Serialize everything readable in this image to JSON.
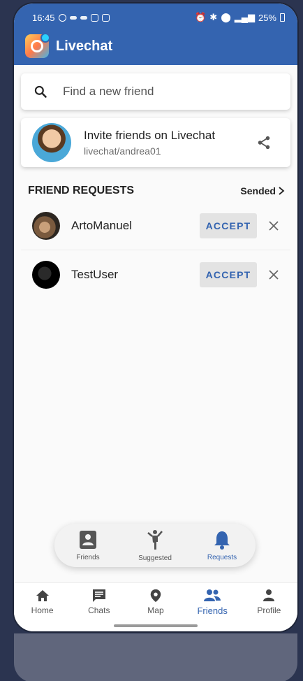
{
  "status": {
    "time": "16:45",
    "battery": "25%"
  },
  "app": {
    "title": "Livechat"
  },
  "search": {
    "placeholder": "Find a new friend"
  },
  "invite": {
    "title": "Invite friends on Livechat",
    "subtitle": "livechat/andrea01"
  },
  "requests": {
    "title": "FRIEND REQUESTS",
    "sended_label": "Sended",
    "items": [
      {
        "name": "ArtoManuel",
        "accept_label": "ACCEPT"
      },
      {
        "name": "TestUser",
        "accept_label": "ACCEPT"
      }
    ]
  },
  "friends_tabs": [
    {
      "label": "Friends",
      "icon": "contact-card-icon"
    },
    {
      "label": "Suggested",
      "icon": "person-wave-icon"
    },
    {
      "label": "Requests",
      "icon": "bell-icon",
      "active": true
    }
  ],
  "bottom_nav": [
    {
      "label": "Home",
      "icon": "home-icon"
    },
    {
      "label": "Chats",
      "icon": "chat-icon"
    },
    {
      "label": "Map",
      "icon": "map-pin-icon"
    },
    {
      "label": "Friends",
      "icon": "people-icon",
      "active": true
    },
    {
      "label": "Profile",
      "icon": "person-icon"
    }
  ],
  "colors": {
    "primary": "#3464b0",
    "background": "#2b3450"
  }
}
